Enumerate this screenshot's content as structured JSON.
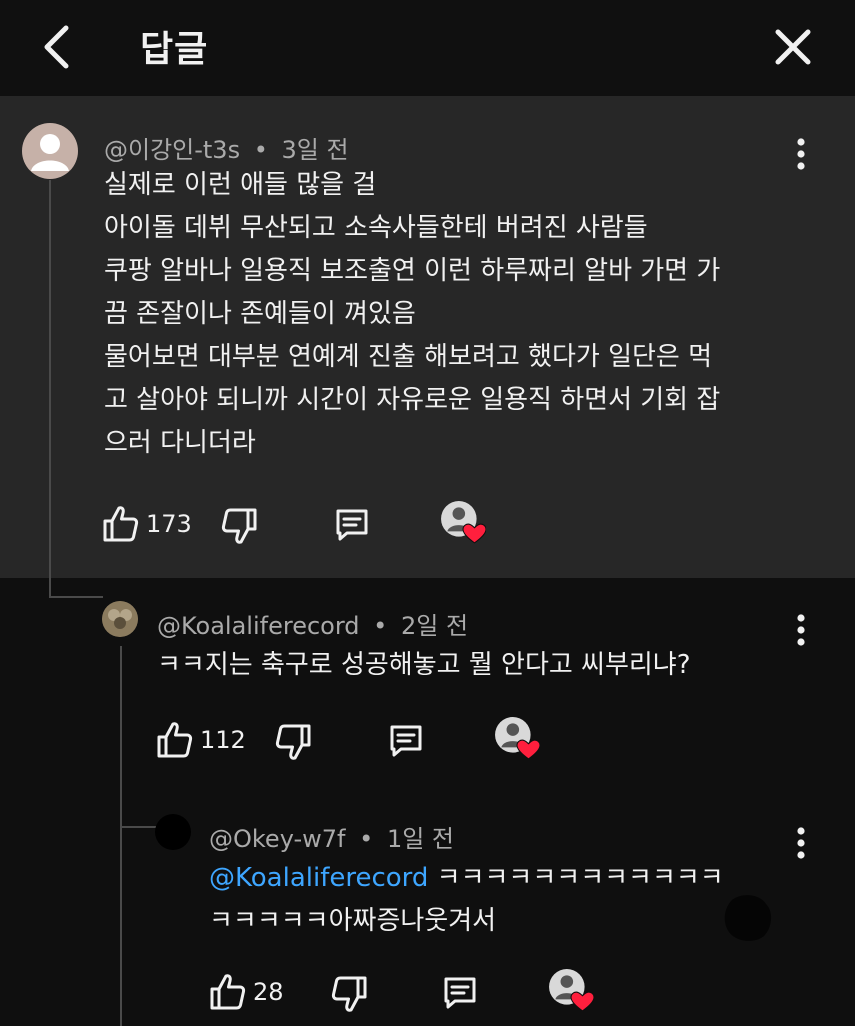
{
  "header": {
    "title": "답글"
  },
  "comments": [
    {
      "handle": "@이강인-t3s",
      "separator": "•",
      "age": "3일 전",
      "lines": [
        "실제로 이런 애들 많을 걸",
        "아이돌 데뷔 무산되고 소속사들한테 버려진 사람들",
        "쿠팡 알바나 일용직 보조출연 이런 하루짜리 알바 가면 가",
        "끔 존잘이나 존예들이 껴있음",
        "물어보면 대부분 연예계 진출 해보려고 했다가 일단은 먹",
        "고 살아야 되니까 시간이 자유로운 일용직 하면서 기회 잡",
        "으러 다니더라"
      ],
      "likes": "173"
    },
    {
      "handle": "@Koalaliferecord",
      "separator": "•",
      "age": "2일 전",
      "lines": [
        "ㅋㅋ지는 축구로 성공해놓고 뭘 안다고 씨부리냐?"
      ],
      "likes": "112"
    },
    {
      "handle": "@Okey-w7f",
      "separator": "•",
      "age": "1일 전",
      "mention": "@Koalaliferecord",
      "line1_rest": " ㅋㅋㅋㅋㅋㅋㅋㅋㅋㅋㅋㅋ",
      "line2": "ㅋㅋㅋㅋㅋ아짜증나웃겨서",
      "likes": "28"
    }
  ],
  "colors": {
    "accent_link": "#3ea6ff",
    "heart": "#ff1f3d",
    "parent_bg": "#272727",
    "page_bg": "#0f0f0f"
  }
}
